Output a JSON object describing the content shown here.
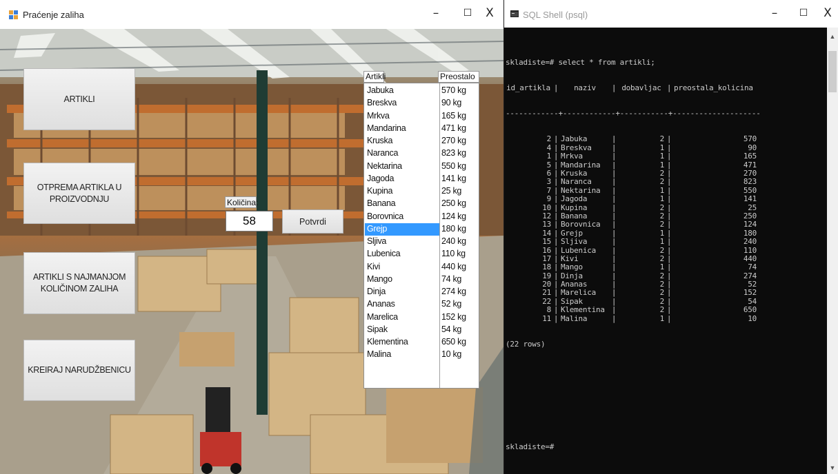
{
  "left_window": {
    "title": "Praćenje zaliha",
    "controls": {
      "minimize": "–",
      "maximize": "☐",
      "close": "X"
    },
    "buttons": [
      {
        "name": "artikli-button",
        "label": "ARTIKLI"
      },
      {
        "name": "otprema-button",
        "label": "OTPREMA ARTIKLA U\nPROIZVODNJU"
      },
      {
        "name": "najmanja-kolicina-button",
        "label": "ARTIKLI S NAJMANJOM\nKOLIČINOM ZALIHA"
      },
      {
        "name": "narudzbenica-button",
        "label": "KREIRAJ NARUDŽBENICU"
      }
    ],
    "kolicina": {
      "label": "Količina:",
      "value": "58"
    },
    "potvrdi_label": "Potvrdi",
    "list": {
      "columns": [
        "Artikli",
        "Preostalo"
      ],
      "selected_index": 11,
      "items": [
        {
          "name": "Jabuka",
          "qty": "570 kg"
        },
        {
          "name": "Breskva",
          "qty": "90 kg"
        },
        {
          "name": "Mrkva",
          "qty": "165 kg"
        },
        {
          "name": "Mandarina",
          "qty": "471 kg"
        },
        {
          "name": "Kruska",
          "qty": "270 kg"
        },
        {
          "name": "Naranca",
          "qty": "823 kg"
        },
        {
          "name": "Nektarina",
          "qty": "550 kg"
        },
        {
          "name": "Jagoda",
          "qty": "141 kg"
        },
        {
          "name": "Kupina",
          "qty": "25 kg"
        },
        {
          "name": "Banana",
          "qty": "250 kg"
        },
        {
          "name": "Borovnica",
          "qty": "124 kg"
        },
        {
          "name": "Grejp",
          "qty": "180 kg"
        },
        {
          "name": "Sljiva",
          "qty": "240 kg"
        },
        {
          "name": "Lubenica",
          "qty": "110 kg"
        },
        {
          "name": "Kivi",
          "qty": "440 kg"
        },
        {
          "name": "Mango",
          "qty": "74 kg"
        },
        {
          "name": "Dinja",
          "qty": "274 kg"
        },
        {
          "name": "Ananas",
          "qty": "52 kg"
        },
        {
          "name": "Marelica",
          "qty": "152 kg"
        },
        {
          "name": "Sipak",
          "qty": "54 kg"
        },
        {
          "name": "Klementina",
          "qty": "650 kg"
        },
        {
          "name": "Malina",
          "qty": "10 kg"
        }
      ]
    }
  },
  "right_window": {
    "title": "SQL Shell (psql)",
    "controls": {
      "minimize": "–",
      "maximize": "☐",
      "close": "X"
    },
    "terminal": {
      "command": "skladiste=# select * from artikli;",
      "headers": [
        "id_artikla",
        "naziv",
        "dobavljac",
        "preostala_kolicina"
      ],
      "separator": "------------+------------+-----------+--------------------",
      "rows": [
        [
          "2",
          "Jabuka",
          "2",
          "570"
        ],
        [
          "4",
          "Breskva",
          "1",
          "90"
        ],
        [
          "1",
          "Mrkva",
          "1",
          "165"
        ],
        [
          "5",
          "Mandarina",
          "1",
          "471"
        ],
        [
          "6",
          "Kruska",
          "2",
          "270"
        ],
        [
          "3",
          "Naranca",
          "2",
          "823"
        ],
        [
          "7",
          "Nektarina",
          "1",
          "550"
        ],
        [
          "9",
          "Jagoda",
          "1",
          "141"
        ],
        [
          "10",
          "Kupina",
          "2",
          "25"
        ],
        [
          "12",
          "Banana",
          "2",
          "250"
        ],
        [
          "13",
          "Borovnica",
          "2",
          "124"
        ],
        [
          "14",
          "Grejp",
          "1",
          "180"
        ],
        [
          "15",
          "Sljiva",
          "1",
          "240"
        ],
        [
          "16",
          "Lubenica",
          "2",
          "110"
        ],
        [
          "17",
          "Kivi",
          "2",
          "440"
        ],
        [
          "18",
          "Mango",
          "1",
          "74"
        ],
        [
          "19",
          "Dinja",
          "2",
          "274"
        ],
        [
          "20",
          "Ananas",
          "2",
          "52"
        ],
        [
          "21",
          "Marelica",
          "2",
          "152"
        ],
        [
          "22",
          "Sipak",
          "2",
          "54"
        ],
        [
          "8",
          "Klementina",
          "2",
          "650"
        ],
        [
          "11",
          "Malina",
          "1",
          "10"
        ]
      ],
      "row_count": "(22 rows)",
      "prompt": "skladiste=#"
    }
  },
  "colors": {
    "selection": "#3399ff",
    "terminal_bg": "#0c0c0c",
    "terminal_text": "#cccccc"
  }
}
